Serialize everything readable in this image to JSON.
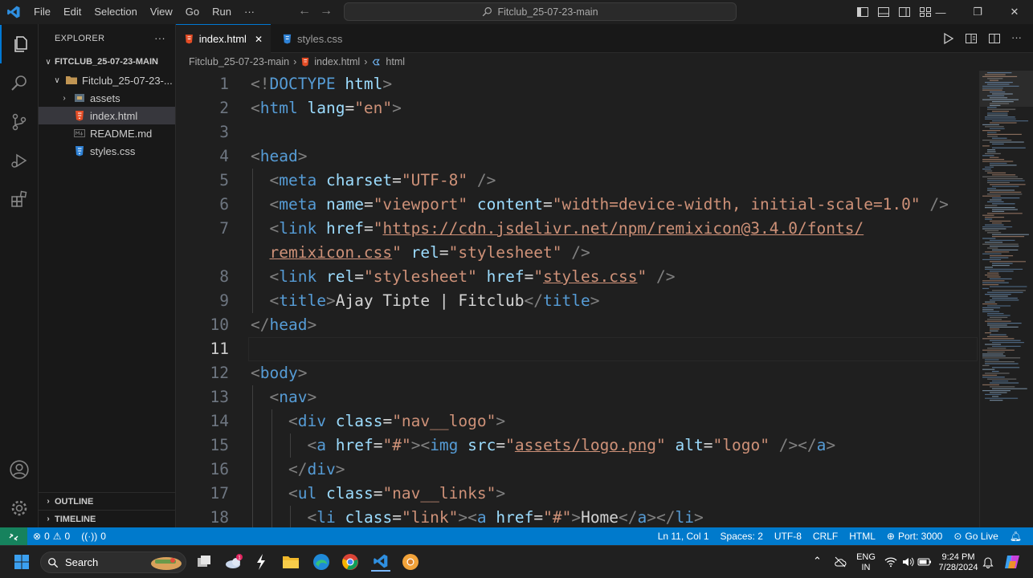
{
  "menu": [
    "File",
    "Edit",
    "Selection",
    "View",
    "Go",
    "Run",
    "···"
  ],
  "search": {
    "text": "Fitclub_25-07-23-main"
  },
  "explorer": {
    "title": "EXPLORER",
    "more": "···",
    "root": "FITCLUB_25-07-23-MAIN",
    "folder": "Fitclub_25-07-23-...",
    "items": [
      {
        "label": "assets",
        "icon": "folder-assets-icon"
      },
      {
        "label": "index.html",
        "icon": "html-file-icon"
      },
      {
        "label": "README.md",
        "icon": "markdown-file-icon"
      },
      {
        "label": "styles.css",
        "icon": "css-file-icon"
      }
    ],
    "outline": "OUTLINE",
    "timeline": "TIMELINE"
  },
  "tabs": [
    {
      "label": "index.html",
      "close": "✕"
    },
    {
      "label": "styles.css"
    }
  ],
  "breadcrumbs": [
    "Fitclub_25-07-23-main",
    "index.html",
    "html"
  ],
  "editor": {
    "current_line": 11,
    "lines": [
      {
        "n": "1",
        "indent": 0,
        "tokens": [
          [
            "br",
            "<!"
          ],
          [
            "tag",
            "DOCTYPE"
          ],
          [
            "txt",
            " "
          ],
          [
            "attr",
            "html"
          ],
          [
            "br",
            ">"
          ]
        ]
      },
      {
        "n": "2",
        "indent": 0,
        "tokens": [
          [
            "br",
            "<"
          ],
          [
            "tag",
            "html"
          ],
          [
            "txt",
            " "
          ],
          [
            "attr",
            "lang"
          ],
          [
            "txt",
            "="
          ],
          [
            "str",
            "\"en\""
          ],
          [
            "br",
            ">"
          ]
        ]
      },
      {
        "n": "3",
        "indent": 0,
        "tokens": []
      },
      {
        "n": "4",
        "indent": 0,
        "tokens": [
          [
            "br",
            "<"
          ],
          [
            "tag",
            "head"
          ],
          [
            "br",
            ">"
          ]
        ]
      },
      {
        "n": "5",
        "indent": 1,
        "tokens": [
          [
            "br",
            "<"
          ],
          [
            "tag",
            "meta"
          ],
          [
            "txt",
            " "
          ],
          [
            "attr",
            "charset"
          ],
          [
            "txt",
            "="
          ],
          [
            "str",
            "\"UTF-8\""
          ],
          [
            "txt",
            " "
          ],
          [
            "br",
            "/>"
          ]
        ]
      },
      {
        "n": "6",
        "indent": 1,
        "tokens": [
          [
            "br",
            "<"
          ],
          [
            "tag",
            "meta"
          ],
          [
            "txt",
            " "
          ],
          [
            "attr",
            "name"
          ],
          [
            "txt",
            "="
          ],
          [
            "str",
            "\"viewport\""
          ],
          [
            "txt",
            " "
          ],
          [
            "attr",
            "content"
          ],
          [
            "txt",
            "="
          ],
          [
            "str",
            "\"width=device-width, initial-scale=1.0\""
          ],
          [
            "txt",
            " "
          ],
          [
            "br",
            "/>"
          ]
        ]
      },
      {
        "n": "7",
        "indent": 1,
        "tokens": [
          [
            "br",
            "<"
          ],
          [
            "tag",
            "link"
          ],
          [
            "txt",
            " "
          ],
          [
            "attr",
            "href"
          ],
          [
            "txt",
            "="
          ],
          [
            "str",
            "\""
          ],
          [
            "link",
            "https://cdn.jsdelivr.net/npm/remixicon@3.4.0/fonts/"
          ]
        ]
      },
      {
        "n": "",
        "indent": 1,
        "tokens": [
          [
            "link",
            "remixicon.css"
          ],
          [
            "str",
            "\""
          ],
          [
            "txt",
            " "
          ],
          [
            "attr",
            "rel"
          ],
          [
            "txt",
            "="
          ],
          [
            "str",
            "\"stylesheet\""
          ],
          [
            "txt",
            " "
          ],
          [
            "br",
            "/>"
          ]
        ]
      },
      {
        "n": "8",
        "indent": 1,
        "tokens": [
          [
            "br",
            "<"
          ],
          [
            "tag",
            "link"
          ],
          [
            "txt",
            " "
          ],
          [
            "attr",
            "rel"
          ],
          [
            "txt",
            "="
          ],
          [
            "str",
            "\"stylesheet\""
          ],
          [
            "txt",
            " "
          ],
          [
            "attr",
            "href"
          ],
          [
            "txt",
            "="
          ],
          [
            "str",
            "\""
          ],
          [
            "link",
            "styles.css"
          ],
          [
            "str",
            "\""
          ],
          [
            "txt",
            " "
          ],
          [
            "br",
            "/>"
          ]
        ]
      },
      {
        "n": "9",
        "indent": 1,
        "tokens": [
          [
            "br",
            "<"
          ],
          [
            "tag",
            "title"
          ],
          [
            "br",
            ">"
          ],
          [
            "txt",
            "Ajay Tipte | Fitclub"
          ],
          [
            "br",
            "</"
          ],
          [
            "tag",
            "title"
          ],
          [
            "br",
            ">"
          ]
        ]
      },
      {
        "n": "10",
        "indent": 0,
        "tokens": [
          [
            "br",
            "</"
          ],
          [
            "tag",
            "head"
          ],
          [
            "br",
            ">"
          ]
        ]
      },
      {
        "n": "11",
        "indent": 0,
        "tokens": []
      },
      {
        "n": "12",
        "indent": 0,
        "tokens": [
          [
            "br",
            "<"
          ],
          [
            "tag",
            "body"
          ],
          [
            "br",
            ">"
          ]
        ]
      },
      {
        "n": "13",
        "indent": 1,
        "tokens": [
          [
            "br",
            "<"
          ],
          [
            "tag",
            "nav"
          ],
          [
            "br",
            ">"
          ]
        ]
      },
      {
        "n": "14",
        "indent": 2,
        "tokens": [
          [
            "br",
            "<"
          ],
          [
            "tag",
            "div"
          ],
          [
            "txt",
            " "
          ],
          [
            "attr",
            "class"
          ],
          [
            "txt",
            "="
          ],
          [
            "str",
            "\"nav__logo\""
          ],
          [
            "br",
            ">"
          ]
        ]
      },
      {
        "n": "15",
        "indent": 3,
        "tokens": [
          [
            "br",
            "<"
          ],
          [
            "tag",
            "a"
          ],
          [
            "txt",
            " "
          ],
          [
            "attr",
            "href"
          ],
          [
            "txt",
            "="
          ],
          [
            "str",
            "\"#\""
          ],
          [
            "br",
            "><"
          ],
          [
            "tag",
            "img"
          ],
          [
            "txt",
            " "
          ],
          [
            "attr",
            "src"
          ],
          [
            "txt",
            "="
          ],
          [
            "str",
            "\""
          ],
          [
            "link",
            "assets/logo.png"
          ],
          [
            "str",
            "\""
          ],
          [
            "txt",
            " "
          ],
          [
            "attr",
            "alt"
          ],
          [
            "txt",
            "="
          ],
          [
            "str",
            "\"logo\""
          ],
          [
            "txt",
            " "
          ],
          [
            "br",
            "/></"
          ],
          [
            "tag",
            "a"
          ],
          [
            "br",
            ">"
          ]
        ]
      },
      {
        "n": "16",
        "indent": 2,
        "tokens": [
          [
            "br",
            "</"
          ],
          [
            "tag",
            "div"
          ],
          [
            "br",
            ">"
          ]
        ]
      },
      {
        "n": "17",
        "indent": 2,
        "tokens": [
          [
            "br",
            "<"
          ],
          [
            "tag",
            "ul"
          ],
          [
            "txt",
            " "
          ],
          [
            "attr",
            "class"
          ],
          [
            "txt",
            "="
          ],
          [
            "str",
            "\"nav__links\""
          ],
          [
            "br",
            ">"
          ]
        ]
      },
      {
        "n": "18",
        "indent": 3,
        "tokens": [
          [
            "br",
            "<"
          ],
          [
            "tag",
            "li"
          ],
          [
            "txt",
            " "
          ],
          [
            "attr",
            "class"
          ],
          [
            "txt",
            "="
          ],
          [
            "str",
            "\"link\""
          ],
          [
            "br",
            "><"
          ],
          [
            "tag",
            "a"
          ],
          [
            "txt",
            " "
          ],
          [
            "attr",
            "href"
          ],
          [
            "txt",
            "="
          ],
          [
            "str",
            "\"#\""
          ],
          [
            "br",
            ">"
          ],
          [
            "txt",
            "Home"
          ],
          [
            "br",
            "</"
          ],
          [
            "tag",
            "a"
          ],
          [
            "br",
            "></"
          ],
          [
            "tag",
            "li"
          ],
          [
            "br",
            ">"
          ]
        ]
      }
    ]
  },
  "status": {
    "errors": "0",
    "warnings": "0",
    "ports": "0",
    "position": "Ln 11, Col 1",
    "spaces": "Spaces: 2",
    "encoding": "UTF-8",
    "eol": "CRLF",
    "language": "HTML",
    "port": "Port: 3000",
    "golive": "Go Live"
  },
  "taskbar": {
    "search": "Search",
    "lang_top": "ENG",
    "lang_bottom": "IN",
    "time": "9:24 PM",
    "date": "7/28/2024",
    "weather_badge": "1"
  },
  "colors": {
    "accent": "#0078d4",
    "statusbar": "#007acc",
    "remote": "#16825d"
  }
}
